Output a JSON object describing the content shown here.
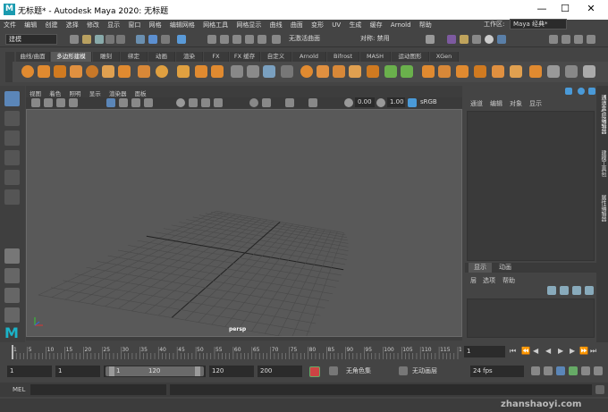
{
  "window": {
    "title": "无标题* - Autodesk Maya 2020: 无标题",
    "logo": "M",
    "minimize": "—",
    "maximize": "☐",
    "close": "✕"
  },
  "menus": [
    "文件",
    "编辑",
    "创建",
    "选择",
    "修改",
    "显示",
    "窗口",
    "网格",
    "编辑网格",
    "网格工具",
    "网格显示",
    "曲线",
    "曲面",
    "变形",
    "UV",
    "生成",
    "缓存",
    "Arnold",
    "帮助"
  ],
  "status": {
    "mode": "建模",
    "no_live": "无激活曲面",
    "symmetry": "对称: 禁用",
    "workspace_label": "工作区:",
    "workspace": "Maya 经典*"
  },
  "shelf_tabs": [
    "曲线/曲面",
    "多边形建模",
    "雕刻",
    "绑定",
    "动画",
    "渲染",
    "FX",
    "FX 缓存",
    "自定义",
    "Arnold",
    "Bifrost",
    "MASH",
    "运动图形",
    "XGen"
  ],
  "shelf_active": 1,
  "viewport": {
    "menus": [
      "视图",
      "着色",
      "照明",
      "显示",
      "渲染器",
      "面板"
    ],
    "near": "0.00",
    "far": "1.00",
    "color_space": "sRGB gamma",
    "camera": "persp"
  },
  "channel_box": {
    "menus": [
      "通道",
      "编辑",
      "对象",
      "显示"
    ]
  },
  "layer_editor": {
    "tabs": [
      "显示",
      "动画"
    ],
    "menus": [
      "层",
      "选项",
      "帮助"
    ]
  },
  "side_tabs": [
    "通道盒/层编辑器",
    "建模工具包",
    "属性编辑器"
  ],
  "timeline": {
    "ticks": [
      "5",
      "10",
      "15",
      "20",
      "25",
      "30",
      "35",
      "40",
      "45",
      "50",
      "55",
      "60",
      "65",
      "70",
      "75",
      "80",
      "85",
      "90",
      "95",
      "100",
      "105",
      "110",
      "115",
      "120"
    ],
    "start_tick": "1",
    "current": "1"
  },
  "range": {
    "start": "1",
    "playback_start": "1",
    "slider_start": "1",
    "slider_end": "120",
    "playback_end": "120",
    "end": "200",
    "character": "无角色集",
    "anim_layer": "无动画层",
    "fps": "24 fps"
  },
  "command": {
    "label": "MEL"
  },
  "watermark": "zhanshaoyi.com"
}
